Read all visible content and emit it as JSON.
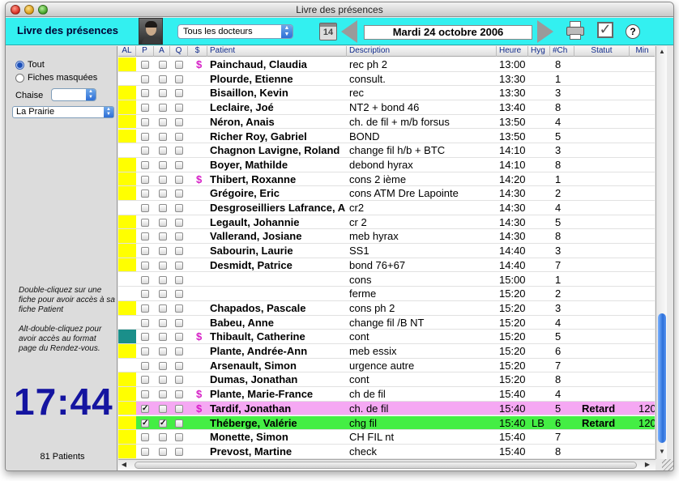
{
  "window": {
    "title": "Livre des présences"
  },
  "toolbar": {
    "app_title": "Livre des présences",
    "doctor_select": "Tous les docteurs",
    "calendar_day": "14",
    "date": "Mardi 24 octobre 2006",
    "help_label": "?"
  },
  "sidebar": {
    "radio_all": "Tout",
    "radio_hidden": "Fiches masquées",
    "chaise_label": "Chaise",
    "chaise_value": "",
    "clinic_select": "La Prairie",
    "help1": "Double-cliquez sur une fiche pour avoir accès à sa fiche Patient",
    "help2": "Alt-double-cliquez pour avoir accès au format page du Rendez-vous.",
    "clock": "17:44",
    "patient_count": "81 Patients"
  },
  "columns": {
    "al": "AL",
    "p": "P",
    "a": "A",
    "q": "Q",
    "dollar": "$",
    "patient": "Patient",
    "description": "Description",
    "heure": "Heure",
    "hyg": "Hyg",
    "ch": "#Ch",
    "statut": "Statut",
    "min": "Min"
  },
  "colors": {
    "accent": "#33f0f0",
    "al_yellow": "#ffff00",
    "al_teal": "#1a8f8a",
    "late_pink": "#f5a8f3",
    "present_green": "#44ee44",
    "dollar_magenta": "#d61ec6",
    "clock_blue": "#1414a0"
  },
  "rows": [
    {
      "al": "yellow",
      "p": false,
      "a": false,
      "q": false,
      "dollar": true,
      "name": "Painchaud, Claudia",
      "desc": "rec ph 2",
      "time": "13:00",
      "hyg": "",
      "ch": "8",
      "status": "",
      "min": "",
      "hl": ""
    },
    {
      "al": "",
      "p": false,
      "a": false,
      "q": false,
      "dollar": false,
      "name": "Plourde, Etienne",
      "desc": "consult.",
      "time": "13:30",
      "hyg": "",
      "ch": "1",
      "status": "",
      "min": "",
      "hl": ""
    },
    {
      "al": "yellow",
      "p": false,
      "a": false,
      "q": false,
      "dollar": false,
      "name": "Bisaillon, Kevin",
      "desc": "rec",
      "time": "13:30",
      "hyg": "",
      "ch": "3",
      "status": "",
      "min": "",
      "hl": ""
    },
    {
      "al": "yellow",
      "p": false,
      "a": false,
      "q": false,
      "dollar": false,
      "name": "Leclaire, Joé",
      "desc": "NT2 + bond  46",
      "time": "13:40",
      "hyg": "",
      "ch": "8",
      "status": "",
      "min": "",
      "hl": ""
    },
    {
      "al": "yellow",
      "p": false,
      "a": false,
      "q": false,
      "dollar": false,
      "name": "Néron, Anais",
      "desc": "ch. de fil + m/b forsus",
      "time": "13:50",
      "hyg": "",
      "ch": "4",
      "status": "",
      "min": "",
      "hl": ""
    },
    {
      "al": "yellow",
      "p": false,
      "a": false,
      "q": false,
      "dollar": false,
      "name": "Richer Roy, Gabriel",
      "desc": "BOND",
      "time": "13:50",
      "hyg": "",
      "ch": "5",
      "status": "",
      "min": "",
      "hl": ""
    },
    {
      "al": "",
      "p": false,
      "a": false,
      "q": false,
      "dollar": false,
      "name": "Chagnon Lavigne, Roland",
      "desc": "change fil h/b + BTC",
      "time": "14:10",
      "hyg": "",
      "ch": "3",
      "status": "",
      "min": "",
      "hl": ""
    },
    {
      "al": "yellow",
      "p": false,
      "a": false,
      "q": false,
      "dollar": false,
      "name": "Boyer, Mathilde",
      "desc": "debond hyrax",
      "time": "14:10",
      "hyg": "",
      "ch": "8",
      "status": "",
      "min": "",
      "hl": ""
    },
    {
      "al": "yellow",
      "p": false,
      "a": false,
      "q": false,
      "dollar": true,
      "name": "Thibert, Roxanne",
      "desc": "cons 2 ième",
      "time": "14:20",
      "hyg": "",
      "ch": "1",
      "status": "",
      "min": "",
      "hl": ""
    },
    {
      "al": "yellow",
      "p": false,
      "a": false,
      "q": false,
      "dollar": false,
      "name": "Grégoire, Eric",
      "desc": "cons ATM Dre Lapointe",
      "time": "14:30",
      "hyg": "",
      "ch": "2",
      "status": "",
      "min": "",
      "hl": ""
    },
    {
      "al": "",
      "p": false,
      "a": false,
      "q": false,
      "dollar": false,
      "name": "Desgroseilliers Lafrance, Ar",
      "desc": "cr2",
      "time": "14:30",
      "hyg": "",
      "ch": "4",
      "status": "",
      "min": "",
      "hl": ""
    },
    {
      "al": "yellow",
      "p": false,
      "a": false,
      "q": false,
      "dollar": false,
      "name": "Legault, Johannie",
      "desc": "cr 2",
      "time": "14:30",
      "hyg": "",
      "ch": "5",
      "status": "",
      "min": "",
      "hl": ""
    },
    {
      "al": "yellow",
      "p": false,
      "a": false,
      "q": false,
      "dollar": false,
      "name": "Vallerand, Josiane",
      "desc": "meb hyrax",
      "time": "14:30",
      "hyg": "",
      "ch": "8",
      "status": "",
      "min": "",
      "hl": ""
    },
    {
      "al": "yellow",
      "p": false,
      "a": false,
      "q": false,
      "dollar": false,
      "name": "Sabourin, Laurie",
      "desc": "SS1",
      "time": "14:40",
      "hyg": "",
      "ch": "3",
      "status": "",
      "min": "",
      "hl": ""
    },
    {
      "al": "yellow",
      "p": false,
      "a": false,
      "q": false,
      "dollar": false,
      "name": "Desmidt, Patrice",
      "desc": "bond 76+67",
      "time": "14:40",
      "hyg": "",
      "ch": "7",
      "status": "",
      "min": "",
      "hl": ""
    },
    {
      "al": "",
      "p": false,
      "a": false,
      "q": false,
      "dollar": false,
      "name": "",
      "desc": "cons",
      "time": "15:00",
      "hyg": "",
      "ch": "1",
      "status": "",
      "min": "",
      "hl": ""
    },
    {
      "al": "",
      "p": false,
      "a": false,
      "q": false,
      "dollar": false,
      "name": "",
      "desc": "ferme",
      "time": "15:20",
      "hyg": "",
      "ch": "2",
      "status": "",
      "min": "",
      "hl": ""
    },
    {
      "al": "yellow",
      "p": false,
      "a": false,
      "q": false,
      "dollar": false,
      "name": "Chapados, Pascale",
      "desc": "cons ph 2",
      "time": "15:20",
      "hyg": "",
      "ch": "3",
      "status": "",
      "min": "",
      "hl": ""
    },
    {
      "al": "",
      "p": false,
      "a": false,
      "q": false,
      "dollar": false,
      "name": "Babeu, Anne",
      "desc": "change fil /B NT",
      "time": "15:20",
      "hyg": "",
      "ch": "4",
      "status": "",
      "min": "",
      "hl": ""
    },
    {
      "al": "teal",
      "p": false,
      "a": false,
      "q": false,
      "dollar": true,
      "name": "Thibault, Catherine",
      "desc": "cont",
      "time": "15:20",
      "hyg": "",
      "ch": "5",
      "status": "",
      "min": "",
      "hl": ""
    },
    {
      "al": "yellow",
      "p": false,
      "a": false,
      "q": false,
      "dollar": false,
      "name": "Plante, Andrée-Ann",
      "desc": "meb essix",
      "time": "15:20",
      "hyg": "",
      "ch": "6",
      "status": "",
      "min": "",
      "hl": ""
    },
    {
      "al": "",
      "p": false,
      "a": false,
      "q": false,
      "dollar": false,
      "name": "Arsenault, Simon",
      "desc": "urgence autre",
      "time": "15:20",
      "hyg": "",
      "ch": "7",
      "status": "",
      "min": "",
      "hl": ""
    },
    {
      "al": "yellow",
      "p": false,
      "a": false,
      "q": false,
      "dollar": false,
      "name": "Dumas, Jonathan",
      "desc": "cont",
      "time": "15:20",
      "hyg": "",
      "ch": "8",
      "status": "",
      "min": "",
      "hl": ""
    },
    {
      "al": "yellow",
      "p": false,
      "a": false,
      "q": false,
      "dollar": true,
      "name": "Plante, Marie-France",
      "desc": "ch de fil",
      "time": "15:40",
      "hyg": "",
      "ch": "4",
      "status": "",
      "min": "",
      "hl": ""
    },
    {
      "al": "yellow",
      "p": true,
      "a": false,
      "q": false,
      "dollar": true,
      "name": "Tardif, Jonathan",
      "desc": "ch. de fil",
      "time": "15:40",
      "hyg": "",
      "ch": "5",
      "status": "Retard",
      "min": "120",
      "hl": "pink"
    },
    {
      "al": "yellow",
      "p": true,
      "a": true,
      "q": false,
      "dollar": false,
      "name": "Théberge, Valérie",
      "desc": "chg fil",
      "time": "15:40",
      "hyg": "LB",
      "ch": "6",
      "status": "Retard",
      "min": "120",
      "hl": "green"
    },
    {
      "al": "yellow",
      "p": false,
      "a": false,
      "q": false,
      "dollar": false,
      "name": "Monette, Simon",
      "desc": "CH FIL nt",
      "time": "15:40",
      "hyg": "",
      "ch": "7",
      "status": "",
      "min": "",
      "hl": ""
    },
    {
      "al": "yellow",
      "p": false,
      "a": false,
      "q": false,
      "dollar": false,
      "name": "Prevost, Martine",
      "desc": "check",
      "time": "15:40",
      "hyg": "",
      "ch": "8",
      "status": "",
      "min": "",
      "hl": ""
    }
  ]
}
